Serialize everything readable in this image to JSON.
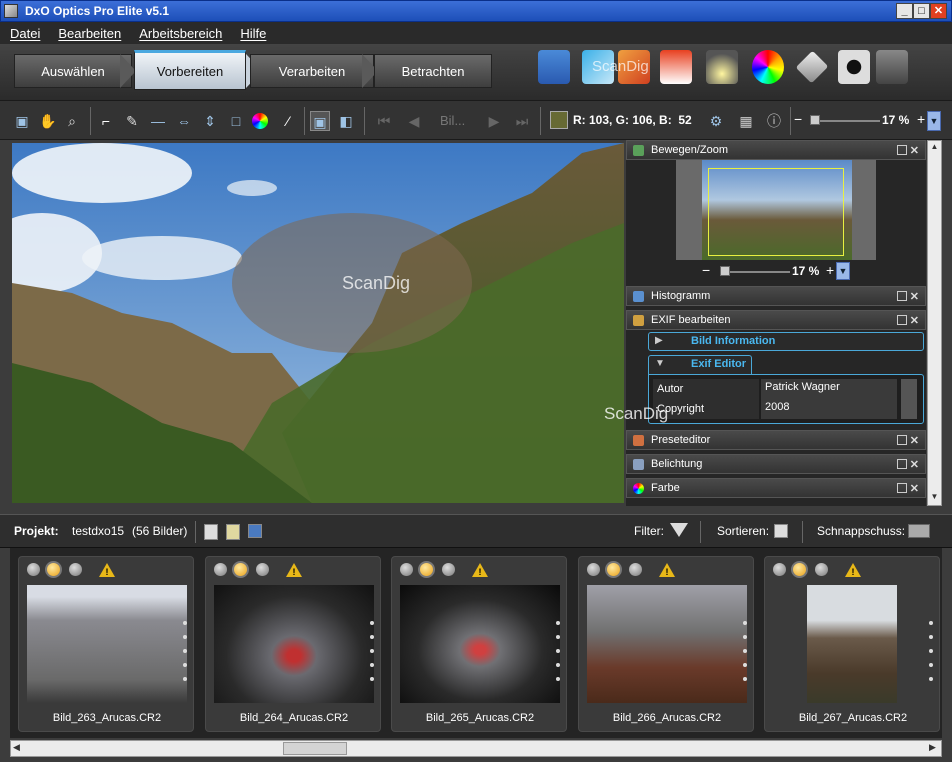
{
  "window": {
    "title": "DxO Optics Pro Elite v5.1",
    "minimize": "_",
    "maximize": "□",
    "close": "✕"
  },
  "menu": [
    "Datei",
    "Bearbeiten",
    "Arbeitsbereich",
    "Hilfe"
  ],
  "workflow_tabs": [
    "Auswählen",
    "Vorbereiten",
    "Verarbeiten",
    "Betrachten"
  ],
  "active_tab": "Vorbereiten",
  "toolbar": {
    "nav_label": "Bil...",
    "rgb_readout": "R: 103, G: 106, B:  52",
    "swatch_color": "#676a34",
    "zoom": "17 %",
    "zoom_minus": "−",
    "zoom_plus": "+"
  },
  "preview": {
    "watermark": "ScanDig"
  },
  "panels": {
    "move_zoom": {
      "title": "Bewegen/Zoom",
      "zoom": "17 %",
      "minus": "−",
      "plus": "+"
    },
    "histogram": {
      "title": "Histogramm"
    },
    "exif": {
      "title": "EXIF bearbeiten",
      "section1": "Bild Information",
      "section2": "Exif Editor",
      "rows": [
        {
          "key": "Autor",
          "value": "Patrick Wagner"
        },
        {
          "key": "Copyright",
          "value": "2008"
        }
      ],
      "watermark": "ScanDig"
    },
    "preset": {
      "title": "Preseteditor"
    },
    "exposure": {
      "title": "Belichtung"
    },
    "color": {
      "title": "Farbe"
    }
  },
  "icons_watermark": "ScanDig",
  "project": {
    "label": "Projekt:",
    "name": "testdxo15",
    "count": "(56 Bilder)",
    "filter": "Filter:",
    "sort": "Sortieren:",
    "snapshot": "Schnappschuss:"
  },
  "thumbnails": [
    {
      "name": "Bild_263_Arucas.CR2"
    },
    {
      "name": "Bild_264_Arucas.CR2"
    },
    {
      "name": "Bild_265_Arucas.CR2"
    },
    {
      "name": "Bild_266_Arucas.CR2"
    },
    {
      "name": "Bild_267_Arucas.CR2"
    }
  ]
}
